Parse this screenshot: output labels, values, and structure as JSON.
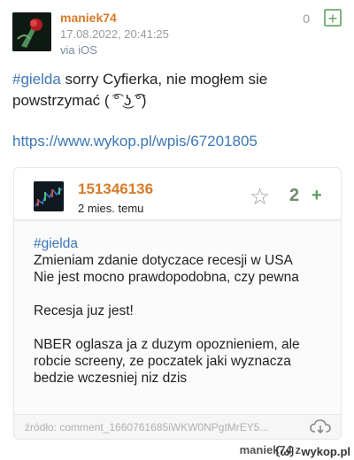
{
  "post": {
    "author": "maniek74",
    "date": "17.08.2022, 20:41:25",
    "via": "via iOS",
    "votes": "0",
    "plus_label": "+",
    "tag": "#gielda",
    "text": " sorry Cyfierka, nie mogłem sie powstrzymać ( ͡° ͜ʖ ͡°)",
    "link": "https://www.wykop.pl/wpis/67201805"
  },
  "embed": {
    "user": "151346136",
    "time": "2 mies. temu",
    "votes": "2",
    "plus_label": "+",
    "star_icon": "☆",
    "tag": "#gielda",
    "lines": [
      "Zmieniam zdanie dotyczace recesji w USA",
      "Nie jest mocno prawdopodobna, czy pewna",
      "Recesja juz jest!",
      "NBER oglasza ja z duzym opoznieniem, ale robcie screeny, ze poczatek jaki wyznacza bedzie wczesniej niz dzis"
    ],
    "source": "źródło: comment_1660761685iWKW0NPgtMrEY5..."
  },
  "footer": {
    "attribution": "maniek74 z",
    "logo": "wykop.pl"
  },
  "colors": {
    "author": "#d77b2a",
    "link": "#3d77b6",
    "vote_green": "#5fa05f"
  }
}
